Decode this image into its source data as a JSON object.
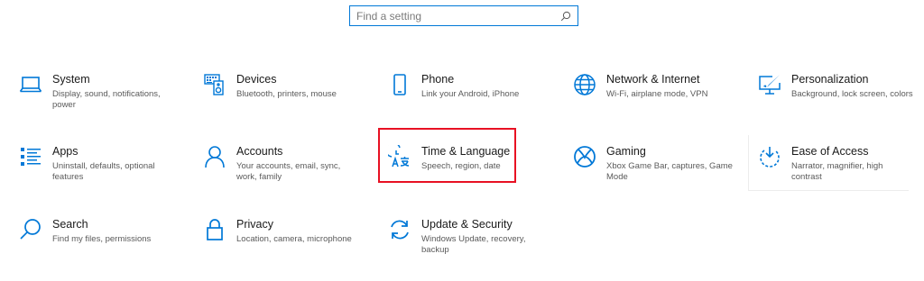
{
  "search": {
    "placeholder": "Find a setting"
  },
  "colors": {
    "accent": "#0078d7",
    "highlight": "#e81123"
  },
  "tiles": [
    {
      "title": "System",
      "desc": "Display, sound, notifications, power",
      "icon": "laptop-icon"
    },
    {
      "title": "Devices",
      "desc": "Bluetooth, printers, mouse",
      "icon": "keyboard-speaker-icon"
    },
    {
      "title": "Phone",
      "desc": "Link your Android, iPhone",
      "icon": "phone-icon"
    },
    {
      "title": "Network & Internet",
      "desc": "Wi-Fi, airplane mode, VPN",
      "icon": "globe-icon"
    },
    {
      "title": "Personalization",
      "desc": "Background, lock screen, colors",
      "icon": "paint-monitor-icon"
    },
    {
      "title": "Apps",
      "desc": "Uninstall, defaults, optional features",
      "icon": "apps-list-icon"
    },
    {
      "title": "Accounts",
      "desc": "Your accounts, email, sync, work, family",
      "icon": "person-icon"
    },
    {
      "title": "Time & Language",
      "desc": "Speech, region, date",
      "icon": "clock-language-icon"
    },
    {
      "title": "Gaming",
      "desc": "Xbox Game Bar, captures, Game Mode",
      "icon": "xbox-icon"
    },
    {
      "title": "Ease of Access",
      "desc": "Narrator, magnifier, high contrast",
      "icon": "ease-of-access-icon"
    },
    {
      "title": "Search",
      "desc": "Find my files, permissions",
      "icon": "search-icon"
    },
    {
      "title": "Privacy",
      "desc": "Location, camera, microphone",
      "icon": "lock-icon"
    },
    {
      "title": "Update & Security",
      "desc": "Windows Update, recovery, backup",
      "icon": "update-icon"
    }
  ]
}
